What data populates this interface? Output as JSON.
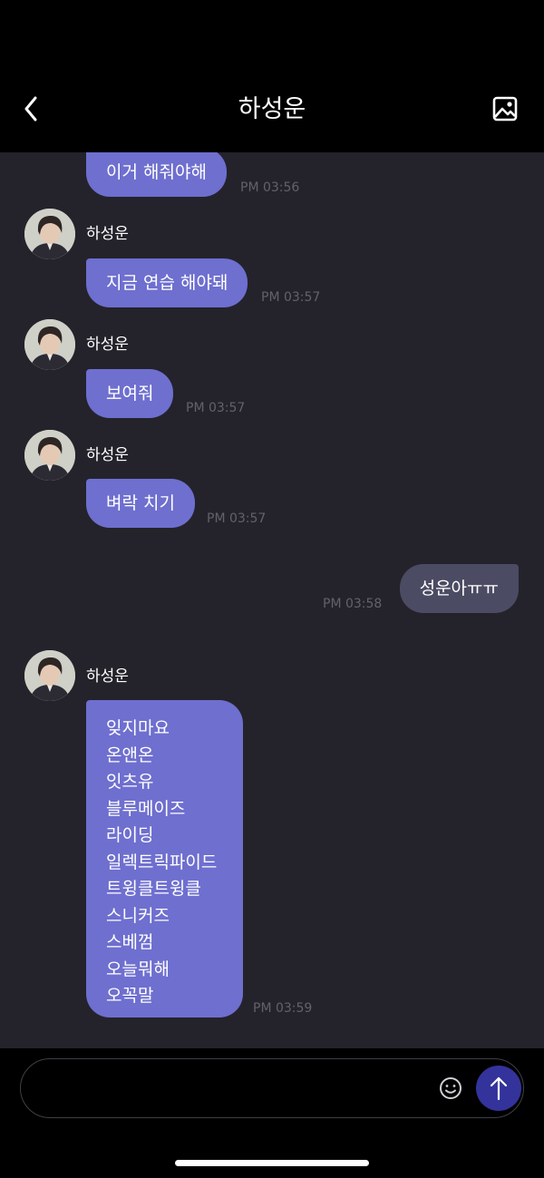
{
  "header": {
    "title": "하성운",
    "back_icon": "chevron-left-icon",
    "gallery_icon": "image-icon"
  },
  "colors": {
    "incoming_bubble": "#6e6fcf",
    "outgoing_bubble": "#4b4b63",
    "chat_background": "#24232b",
    "send_button": "#33339b"
  },
  "messages": [
    {
      "sender": "",
      "text": "이거 해줘야해",
      "time": "PM 03:56"
    },
    {
      "sender": "하성운",
      "text": "지금 연습 해야돼",
      "time": "PM 03:57"
    },
    {
      "sender": "하성운",
      "text": "보여줘",
      "time": "PM 03:57"
    },
    {
      "sender": "하성운",
      "text": "벼락 치기",
      "time": "PM 03:57"
    },
    {
      "sender": "",
      "text": "성운아ㅠㅠ",
      "time": "PM 03:58"
    },
    {
      "sender": "하성운",
      "lines": [
        "잊지마요",
        "온앤온",
        "잇츠유",
        "블루메이즈",
        "라이딩",
        "일렉트릭파이드",
        "트윙클트윙클",
        "스니커즈",
        "스베껌",
        "오늘뭐해",
        "오꼭말"
      ],
      "time": "PM 03:59"
    }
  ],
  "composer": {
    "placeholder": "",
    "emoji_icon": "smiley-icon",
    "send_icon": "arrow-up-icon"
  }
}
